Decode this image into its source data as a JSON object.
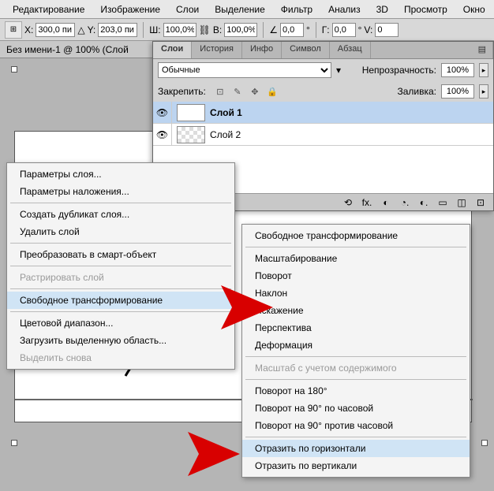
{
  "menubar": [
    "Редактирование",
    "Изображение",
    "Слои",
    "Выделение",
    "Фильтр",
    "Анализ",
    "3D",
    "Просмотр",
    "Окно"
  ],
  "options": {
    "x_label": "X:",
    "x": "300,0 пи",
    "y_label": "Y:",
    "y": "203,0 пи",
    "w_label": "Ш:",
    "w": "100,0%",
    "h_label": "В:",
    "h": "100,0%",
    "a_label": "∠",
    "a": "0,0",
    "g_label": "Г:",
    "g": "0,0",
    "v_label": "V:",
    "v": "0"
  },
  "doc_title": "Без имени-1 @ 100% (Слой",
  "panel": {
    "tabs": [
      "Слои",
      "История",
      "Инфо",
      "Символ",
      "Абзац"
    ],
    "mode": "Обычные",
    "opacity_label": "Непрозрачность:",
    "opacity": "100%",
    "lock_label": "Закрепить:",
    "fill_label": "Заливка:",
    "fill": "100%",
    "layers": [
      {
        "name": "Слой 1",
        "selected": true,
        "check": false
      },
      {
        "name": "Слой 2",
        "selected": false,
        "check": true
      }
    ],
    "footer": [
      "⟲",
      "fx.",
      "◐",
      "◔.",
      "◐.",
      "▭",
      "◫",
      "⊡"
    ]
  },
  "ctx1": [
    {
      "t": "Параметры слоя..."
    },
    {
      "t": "Параметры наложения..."
    },
    {
      "sep": true
    },
    {
      "t": "Создать дубликат слоя..."
    },
    {
      "t": "Удалить слой"
    },
    {
      "sep": true
    },
    {
      "t": "Преобразовать в смарт-объект"
    },
    {
      "sep": true
    },
    {
      "t": "Растрировать слой",
      "dis": true
    },
    {
      "sep": true
    },
    {
      "t": "Свободное трансформирование",
      "hl": true
    },
    {
      "sep": true
    },
    {
      "t": "Цветовой диапазон..."
    },
    {
      "t": "Загрузить выделенную область..."
    },
    {
      "t": "Выделить снова",
      "dis": true
    }
  ],
  "ctx2": [
    {
      "t": "Свободное трансформирование"
    },
    {
      "sep": true
    },
    {
      "t": "Масштабирование"
    },
    {
      "t": "Поворот"
    },
    {
      "t": "Наклон"
    },
    {
      "t": "Искажение"
    },
    {
      "t": "Перспектива"
    },
    {
      "t": "Деформация"
    },
    {
      "sep": true
    },
    {
      "t": "Масштаб с учетом содержимого",
      "dis": true
    },
    {
      "sep": true
    },
    {
      "t": "Поворот на 180°"
    },
    {
      "t": "Поворот на 90° по часовой"
    },
    {
      "t": "Поворот на 90° против часовой"
    },
    {
      "sep": true
    },
    {
      "t": "Отразить по горизонтали",
      "hl": true
    },
    {
      "t": "Отразить по вертикали"
    }
  ]
}
